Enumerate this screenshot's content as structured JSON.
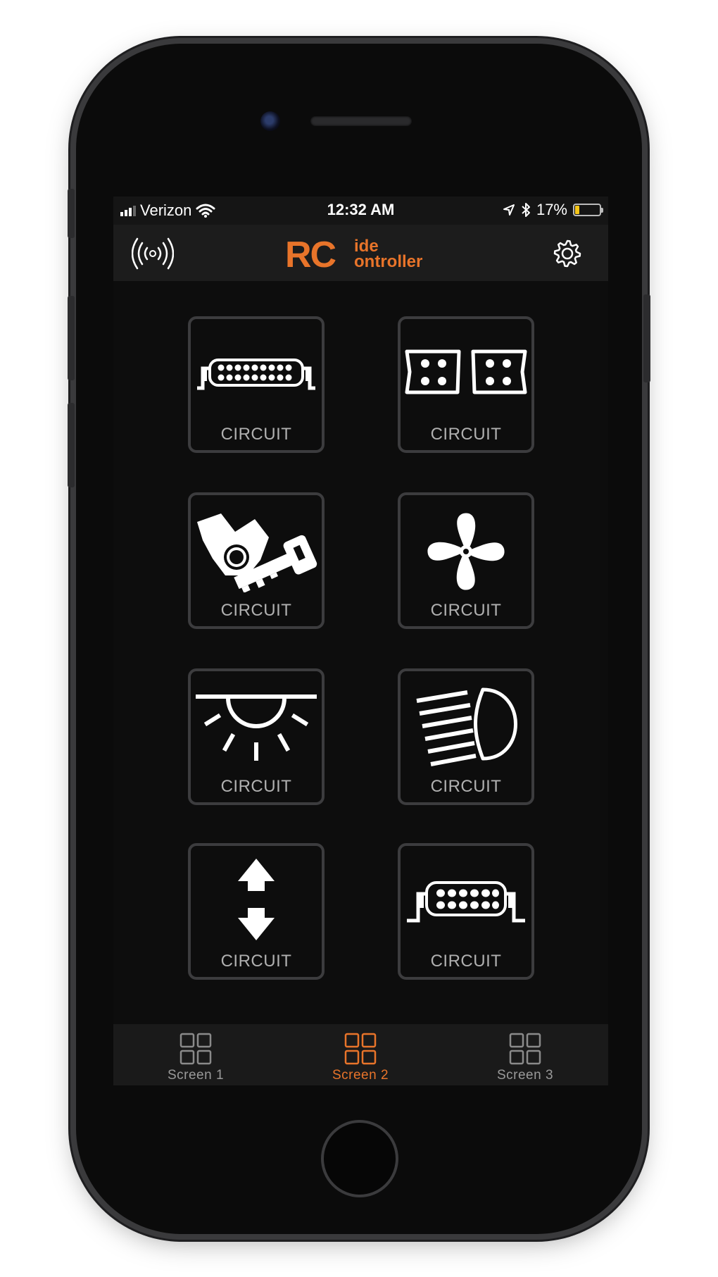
{
  "status_bar": {
    "carrier": "Verizon",
    "time": "12:32 AM",
    "battery": "17%",
    "battery_level": 0.17
  },
  "header": {
    "logo_big": "RC",
    "logo_top": "ide",
    "logo_bottom": "ontroller",
    "left_icon": "wireless-signal-icon",
    "right_icon": "gear-icon"
  },
  "colors": {
    "accent": "#e8742a",
    "tile_border": "#3c3c3e",
    "label": "#b0b0b0",
    "background": "#0d0d0d"
  },
  "tiles": [
    {
      "label": "CIRCUIT",
      "icon": "light-bar-icon"
    },
    {
      "label": "CIRCUIT",
      "icon": "dual-pod-lights-icon"
    },
    {
      "label": "CIRCUIT",
      "icon": "engine-key-icon"
    },
    {
      "label": "CIRCUIT",
      "icon": "fan-icon"
    },
    {
      "label": "CIRCUIT",
      "icon": "dome-light-icon"
    },
    {
      "label": "CIRCUIT",
      "icon": "headlight-icon"
    },
    {
      "label": "CIRCUIT",
      "icon": "up-down-arrows-icon"
    },
    {
      "label": "CIRCUIT",
      "icon": "light-bar-icon"
    }
  ],
  "tabs": [
    {
      "label": "Screen 1",
      "active": false
    },
    {
      "label": "Screen 2",
      "active": true
    },
    {
      "label": "Screen 3",
      "active": false
    }
  ]
}
